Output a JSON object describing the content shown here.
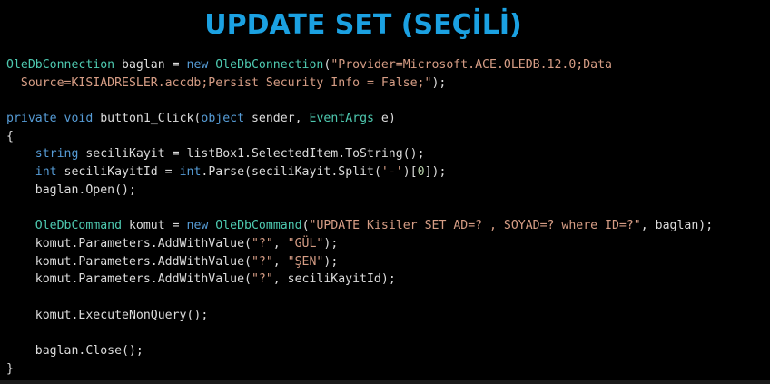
{
  "title": "UPDATE SET (SEÇİLİ)",
  "colors": {
    "background": "#000000",
    "title": "#1ba1e2",
    "plain": "#dcdcdc",
    "keyword": "#569cd6",
    "type": "#4ec9b0",
    "string": "#d69d85",
    "number": "#b5cea8"
  },
  "code": {
    "lines": [
      [
        {
          "t": "OleDbConnection",
          "c": "type"
        },
        {
          "t": " baglan = ",
          "c": "plain"
        },
        {
          "t": "new",
          "c": "keyword"
        },
        {
          "t": " ",
          "c": "plain"
        },
        {
          "t": "OleDbConnection",
          "c": "type"
        },
        {
          "t": "(",
          "c": "plain"
        },
        {
          "t": "\"Provider=Microsoft.ACE.OLEDB.12.0;Data",
          "c": "string"
        }
      ],
      [
        {
          "t": "  Source=KISIADRESLER.accdb;Persist Security Info = False;\"",
          "c": "string"
        },
        {
          "t": ");",
          "c": "plain"
        }
      ],
      [],
      [
        {
          "t": "private",
          "c": "keyword"
        },
        {
          "t": " ",
          "c": "plain"
        },
        {
          "t": "void",
          "c": "keyword"
        },
        {
          "t": " button1_Click(",
          "c": "plain"
        },
        {
          "t": "object",
          "c": "keyword"
        },
        {
          "t": " sender, ",
          "c": "plain"
        },
        {
          "t": "EventArgs",
          "c": "type"
        },
        {
          "t": " e)",
          "c": "plain"
        }
      ],
      [
        {
          "t": "{",
          "c": "plain"
        }
      ],
      [
        {
          "t": "    ",
          "c": "plain"
        },
        {
          "t": "string",
          "c": "keyword"
        },
        {
          "t": " seciliKayit = listBox1.SelectedItem.ToString();",
          "c": "plain"
        }
      ],
      [
        {
          "t": "    ",
          "c": "plain"
        },
        {
          "t": "int",
          "c": "keyword"
        },
        {
          "t": " seciliKayitId = ",
          "c": "plain"
        },
        {
          "t": "int",
          "c": "keyword"
        },
        {
          "t": ".Parse(seciliKayit.Split(",
          "c": "plain"
        },
        {
          "t": "'-'",
          "c": "string"
        },
        {
          "t": ")[",
          "c": "plain"
        },
        {
          "t": "0",
          "c": "number"
        },
        {
          "t": "]);",
          "c": "plain"
        }
      ],
      [
        {
          "t": "    baglan.Open();",
          "c": "plain"
        }
      ],
      [],
      [
        {
          "t": "    ",
          "c": "plain"
        },
        {
          "t": "OleDbCommand",
          "c": "type"
        },
        {
          "t": " komut = ",
          "c": "plain"
        },
        {
          "t": "new",
          "c": "keyword"
        },
        {
          "t": " ",
          "c": "plain"
        },
        {
          "t": "OleDbCommand",
          "c": "type"
        },
        {
          "t": "(",
          "c": "plain"
        },
        {
          "t": "\"UPDATE Kisiler SET AD=? , SOYAD=? where ID=?\"",
          "c": "string"
        },
        {
          "t": ", baglan);",
          "c": "plain"
        }
      ],
      [
        {
          "t": "    komut.Parameters.AddWithValue(",
          "c": "plain"
        },
        {
          "t": "\"?\"",
          "c": "string"
        },
        {
          "t": ", ",
          "c": "plain"
        },
        {
          "t": "\"GÜL\"",
          "c": "string"
        },
        {
          "t": ");",
          "c": "plain"
        }
      ],
      [
        {
          "t": "    komut.Parameters.AddWithValue(",
          "c": "plain"
        },
        {
          "t": "\"?\"",
          "c": "string"
        },
        {
          "t": ", ",
          "c": "plain"
        },
        {
          "t": "\"ŞEN\"",
          "c": "string"
        },
        {
          "t": ");",
          "c": "plain"
        }
      ],
      [
        {
          "t": "    komut.Parameters.AddWithValue(",
          "c": "plain"
        },
        {
          "t": "\"?\"",
          "c": "string"
        },
        {
          "t": ", seciliKayitId);",
          "c": "plain"
        }
      ],
      [],
      [
        {
          "t": "    komut.ExecuteNonQuery();",
          "c": "plain"
        }
      ],
      [],
      [
        {
          "t": "    baglan.Close();",
          "c": "plain"
        }
      ],
      [
        {
          "t": "}",
          "c": "plain"
        }
      ]
    ]
  }
}
